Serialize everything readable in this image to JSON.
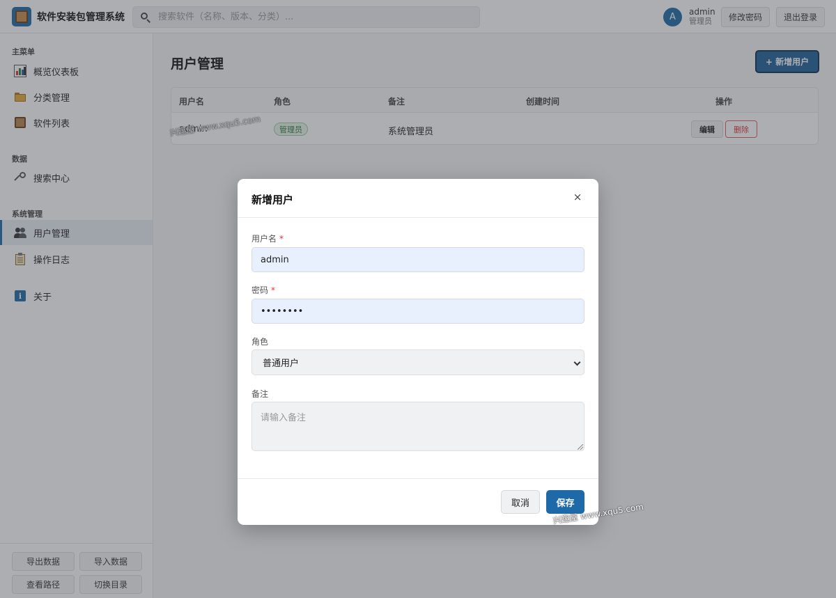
{
  "header": {
    "app_title": "软件安装包管理系统",
    "search_placeholder": "搜索软件（名称、版本、分类）...",
    "avatar_letter": "A",
    "user_name": "admin",
    "user_role": "管理员",
    "change_password": "修改密码",
    "logout": "退出登录"
  },
  "sidebar": {
    "sections": [
      "主菜单",
      "数据",
      "系统管理"
    ],
    "items": [
      {
        "label": "概览仪表板",
        "icon": "chart-icon"
      },
      {
        "label": "分类管理",
        "icon": "folder-icon"
      },
      {
        "label": "软件列表",
        "icon": "box-icon"
      },
      {
        "label": "搜索中心",
        "icon": "search-key-icon"
      },
      {
        "label": "用户管理",
        "icon": "users-icon",
        "active": true
      },
      {
        "label": "操作日志",
        "icon": "clipboard-icon"
      },
      {
        "label": "关于",
        "icon": "info-icon"
      }
    ],
    "footer_buttons": [
      "导出数据",
      "导入数据",
      "查看路径",
      "切换目录"
    ]
  },
  "main": {
    "page_title": "用户管理",
    "add_button": "+ 新增用户",
    "table": {
      "columns": [
        "用户名",
        "角色",
        "备注",
        "创建时间",
        "操作"
      ],
      "rows": [
        {
          "username": "admin",
          "role": "管理员",
          "note": "系统管理员",
          "created": "",
          "edit": "编辑",
          "delete": "删除"
        }
      ]
    }
  },
  "modal": {
    "title": "新增用户",
    "close": "×",
    "username_label": "用户名",
    "username_value": "admin",
    "password_label": "密码",
    "password_value": "••••••••",
    "required_mark": "*",
    "role_label": "角色",
    "role_value": "普通用户",
    "note_label": "备注",
    "note_placeholder": "请输入备注",
    "cancel": "取消",
    "save": "保存"
  },
  "watermark": "兴趣屋 www.xqu5.com",
  "colors": {
    "accent": "#1e6aa8",
    "danger": "#d33333",
    "success": "#2c7a3a"
  }
}
